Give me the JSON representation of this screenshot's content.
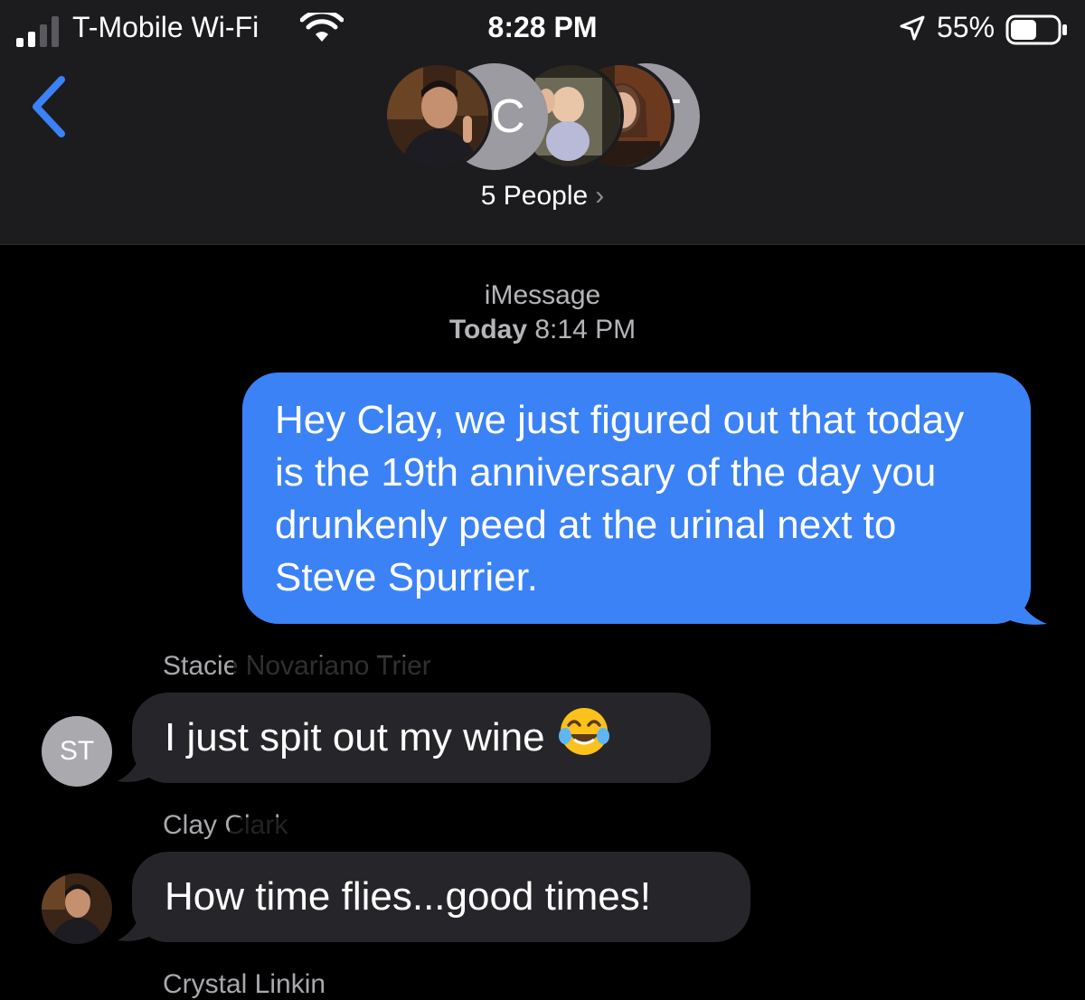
{
  "status_bar": {
    "carrier": "T-Mobile Wi-Fi",
    "time": "8:28 PM",
    "battery_percent": "55%",
    "battery_level": 0.55
  },
  "header": {
    "group_letters": [
      "C",
      "T"
    ],
    "people_label": "5 People",
    "people_chevron": "›",
    "accent_color": "#3b82f6"
  },
  "thread": {
    "service": "iMessage",
    "day": "Today",
    "time": "8:14 PM"
  },
  "messages": [
    {
      "direction": "outgoing",
      "text": "Hey Clay, we just figured out that today is the 19th anniversary of the day you drunkenly peed at the urinal next to Steve Spurrier.",
      "bubble_color": "#3b82f6"
    },
    {
      "direction": "incoming",
      "sender": "Stacie Novariano Trier",
      "avatar_initials": "ST",
      "text": "I just spit out my wine",
      "emoji": "face-with-tears-of-joy-icon"
    },
    {
      "direction": "incoming",
      "sender": "Clay Clark",
      "text": "How time flies...good times!"
    }
  ],
  "next_sender": "Crystal Linkin",
  "icons": {
    "back": "chevron-left-icon",
    "signal": "cell-signal-icon",
    "wifi": "wifi-icon",
    "location": "location-arrow-icon",
    "battery": "battery-icon"
  }
}
